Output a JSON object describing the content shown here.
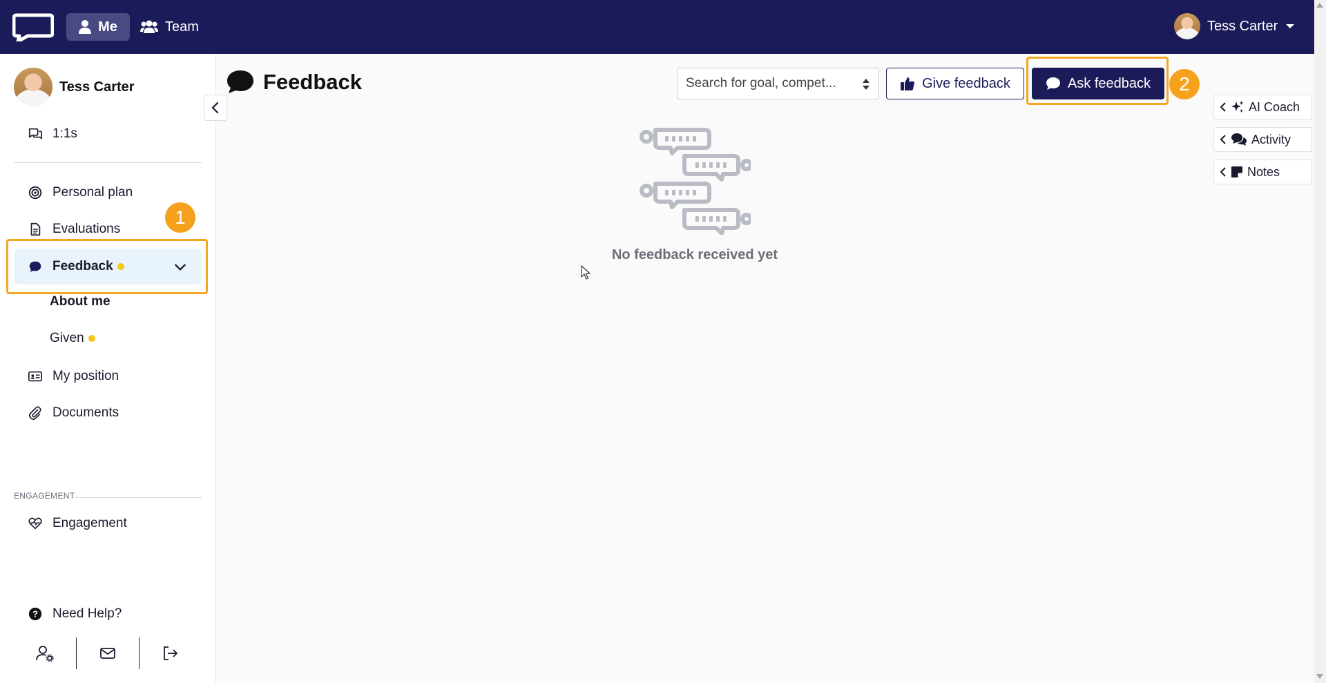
{
  "topbar": {
    "nav_me": "Me",
    "nav_team": "Team",
    "user_name": "Tess Carter"
  },
  "sidebar": {
    "profile_name": "Tess Carter",
    "items": [
      {
        "label": "1:1s",
        "icon": "chat-bubbles-icon"
      },
      {
        "label": "Personal plan",
        "icon": "target-icon"
      },
      {
        "label": "Evaluations",
        "icon": "document-icon"
      },
      {
        "label": "Feedback",
        "icon": "speech-bubble-icon",
        "active": true
      },
      {
        "label": "My position",
        "icon": "id-card-icon"
      },
      {
        "label": "Documents",
        "icon": "paperclip-icon"
      },
      {
        "label": "Engagement",
        "icon": "heart-pulse-icon"
      }
    ],
    "sub_items": [
      {
        "label": "About me",
        "selected": true
      },
      {
        "label": "Given"
      }
    ],
    "section_label": "ENGAGEMENT",
    "help_label": "Need Help?",
    "bottom_icons": [
      "user-settings-icon",
      "mail-icon",
      "logout-icon"
    ]
  },
  "main": {
    "title": "Feedback",
    "search_placeholder": "Search for goal, compet...",
    "give_feedback": "Give feedback",
    "ask_feedback": "Ask feedback",
    "empty_state": "No feedback received yet"
  },
  "right_panels": [
    {
      "label": "AI Coach",
      "icon": "sparkles-icon"
    },
    {
      "label": "Activity",
      "icon": "comments-icon"
    },
    {
      "label": "Notes",
      "icon": "sticky-note-icon"
    }
  ],
  "annotations": {
    "step1": "1",
    "step2": "2"
  },
  "colors": {
    "brand_navy": "#1b1b5a",
    "highlight_orange": "#f5a623",
    "active_bg": "#e8f3fc",
    "notification_dot": "#f7c71a"
  }
}
